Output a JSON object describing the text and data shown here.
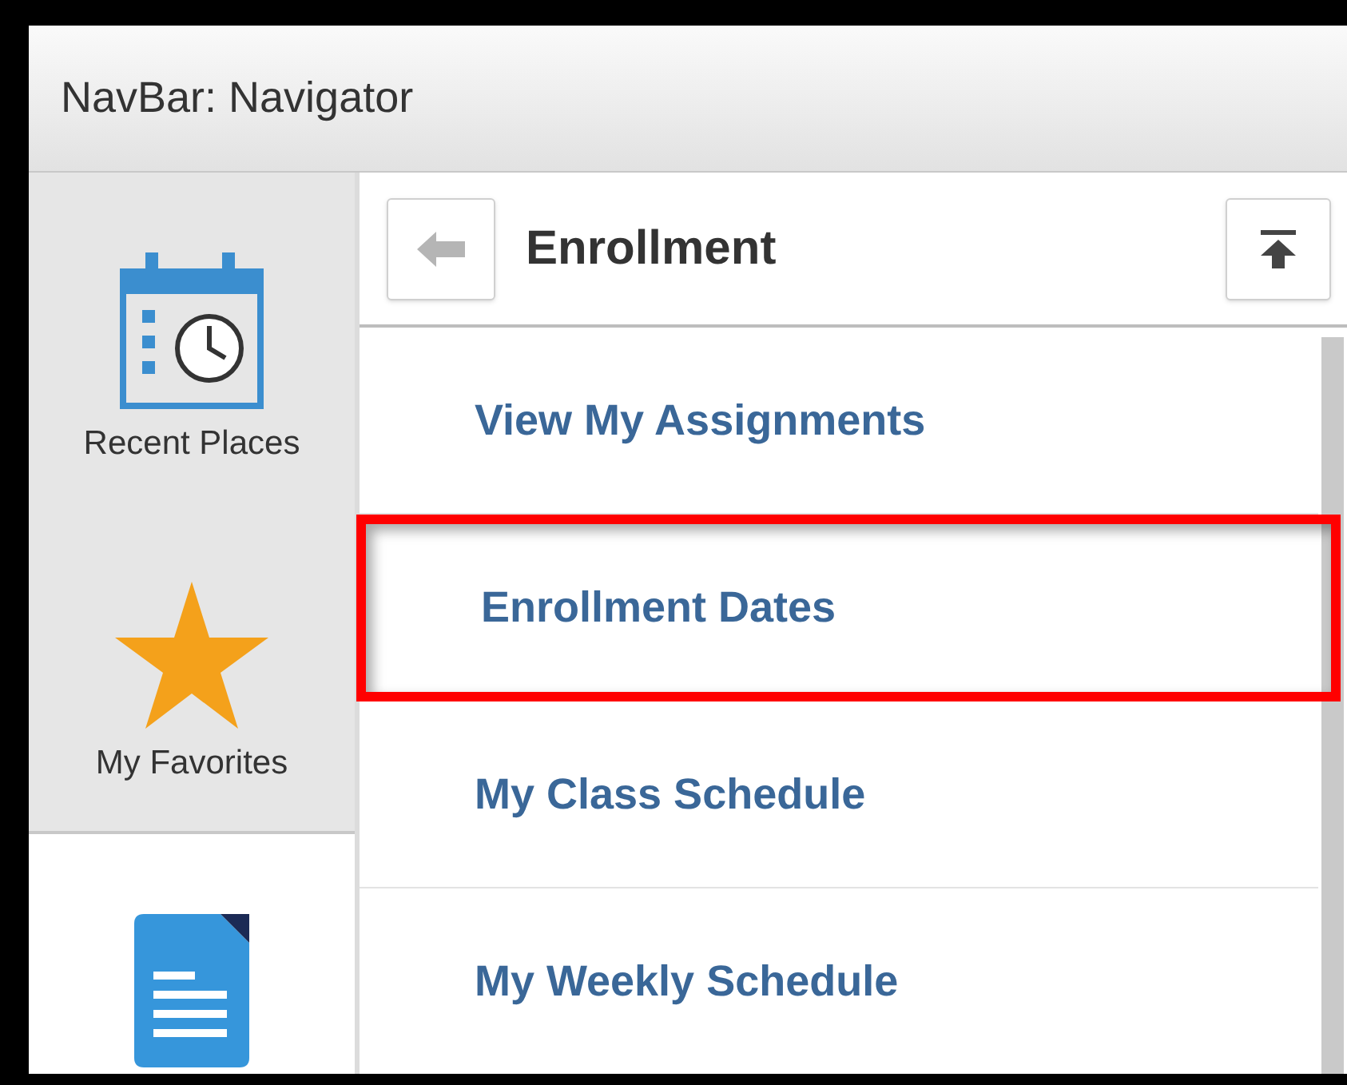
{
  "window": {
    "title": "NavBar: Navigator"
  },
  "sidebar": {
    "items": [
      {
        "label": "Recent Places",
        "kind": "calendar",
        "selected": false
      },
      {
        "label": "My Favorites",
        "kind": "star",
        "selected": false
      },
      {
        "kind": "document",
        "selected": true
      }
    ]
  },
  "panel": {
    "title": "Enrollment",
    "items": [
      {
        "label": "View My Assignments",
        "highlighted": false
      },
      {
        "label": "Enrollment Dates",
        "highlighted": true
      },
      {
        "label": "My Class Schedule",
        "highlighted": false
      },
      {
        "label": "My Weekly Schedule",
        "highlighted": false
      }
    ]
  }
}
